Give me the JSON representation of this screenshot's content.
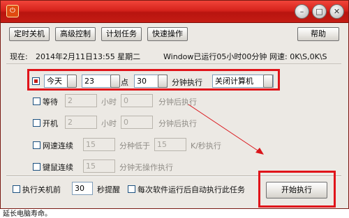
{
  "window": {
    "title": "",
    "app_icon": "power-icon",
    "controls": {
      "minimize": "–",
      "restore": "□",
      "close": "✕"
    }
  },
  "toolbar": {
    "scheduled_shutdown": "定时关机",
    "advanced_control": "高级控制",
    "plan_tasks": "计划任务",
    "quick_operation": "快速操作",
    "help": "帮助"
  },
  "status": {
    "now_prefix": "现在:",
    "datetime": "2014年2月11日13:55 星期二",
    "uptime": "Window已运行05小时00分钟",
    "net_speed": "网速: 0K\\S,0K\\S"
  },
  "row_today": {
    "day": "今天",
    "hour": "23",
    "hour_unit": "点",
    "minute": "30",
    "suffix": "分钟执行",
    "action": "关闭计算机"
  },
  "row_wait": {
    "label": "等待",
    "hours": "2",
    "hours_unit": "小时",
    "minutes": "0",
    "suffix": "分钟后执行"
  },
  "row_boot": {
    "label": "开机",
    "hours": "2",
    "hours_unit": "小时",
    "minutes": "0",
    "suffix": "分钟后执行"
  },
  "row_net": {
    "label": "网速连续",
    "minutes": "15",
    "middle": "分种低于",
    "speed": "15",
    "suffix": "K/秒执行"
  },
  "row_idle": {
    "label": "键鼠连续",
    "minutes": "15",
    "suffix": "分钟无操作执行"
  },
  "footer": {
    "remind_label": "执行关机前",
    "remind_seconds": "30",
    "remind_suffix": "秒提醒",
    "auto_run_label": "每次软件运行后自动执行此任务",
    "start_button": "开始执行"
  },
  "below_text": "延长电脑寿命。",
  "colors": {
    "title_red": "#d6231c",
    "highlight_red": "#e0141a",
    "window_bg": "#ece9e4"
  }
}
